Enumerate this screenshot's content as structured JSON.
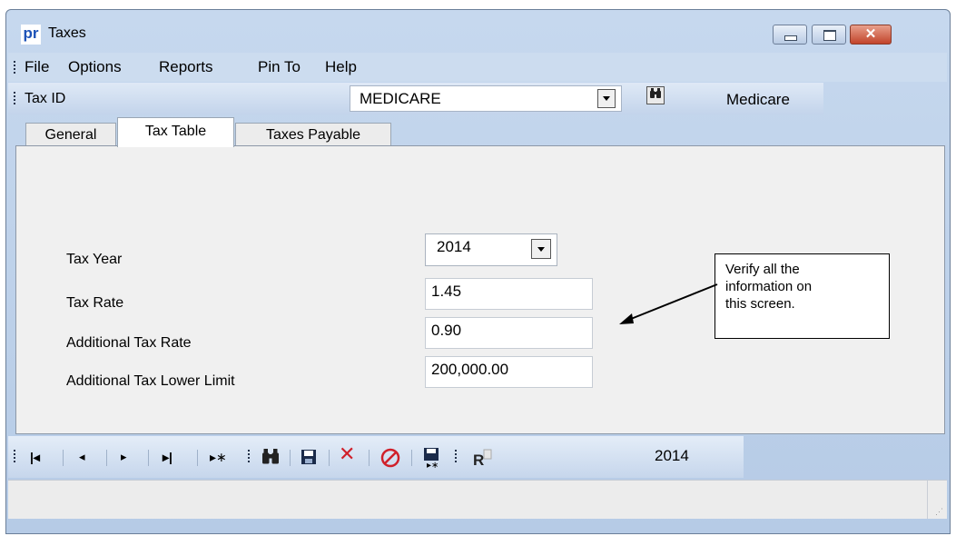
{
  "window": {
    "title": "Taxes",
    "app_logo": "pr"
  },
  "menu": [
    "File",
    "Options",
    "Reports",
    "Pin To",
    "Help"
  ],
  "tax_id_bar": {
    "label": "Tax ID",
    "value": "MEDICARE",
    "description": "Medicare"
  },
  "tabs": [
    {
      "label": "General",
      "selected": false
    },
    {
      "label": "Tax Table",
      "selected": true
    },
    {
      "label": "Taxes Payable",
      "selected": false
    }
  ],
  "form": {
    "tax_year": {
      "label": "Tax Year",
      "value": "2014"
    },
    "tax_rate": {
      "label": "Tax Rate",
      "value": "1.45"
    },
    "additional_tax_rate": {
      "label": "Additional Tax Rate",
      "value": "0.90"
    },
    "additional_tax_lower_limit": {
      "label": "Additional Tax Lower Limit",
      "value": "200,000.00"
    }
  },
  "callout": {
    "lines": [
      "Verify all the",
      "information on",
      "this screen."
    ]
  },
  "nav_toolbar": {
    "buttons": [
      "first-record",
      "previous-record",
      "next-record",
      "last-record",
      "new-record",
      "find",
      "save",
      "delete",
      "cancel",
      "save-and-new"
    ],
    "year": "2014"
  },
  "icons": {
    "first": "⏮",
    "prev": "◀",
    "next": "▶",
    "last": "⏭",
    "new": "▸*",
    "delete": "✕",
    "cancel": "⊘"
  },
  "colors": {
    "delete": "#d0202a",
    "cancel": "#d0202a",
    "logo": "#1c52b7"
  }
}
